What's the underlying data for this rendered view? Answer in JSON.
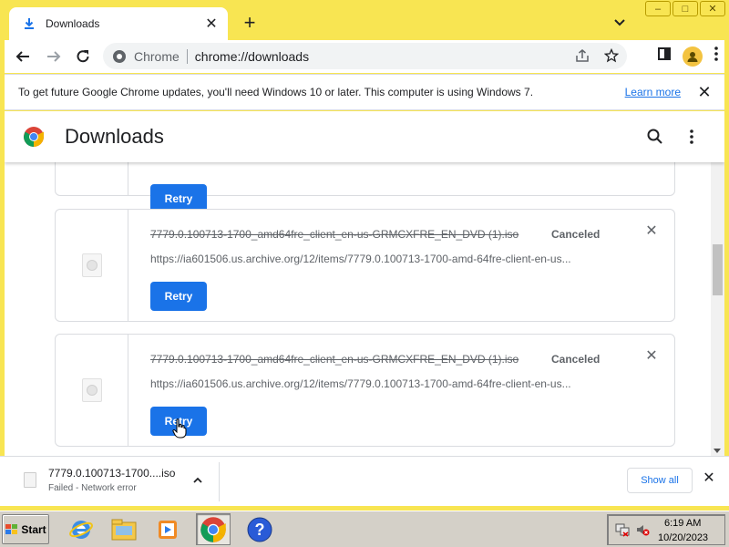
{
  "window": {
    "tab_title": "Downloads",
    "new_tab_label": "+",
    "tab_close_label": "✕",
    "controls": {
      "minimize": "–",
      "maximize": "□",
      "close": "✕"
    }
  },
  "toolbar": {
    "site_name": "Chrome",
    "url": "chrome://downloads"
  },
  "infobar": {
    "message": "To get future Google Chrome updates, you'll need Windows 10 or later. This computer is using Windows 7.",
    "link": "Learn more",
    "close_label": "✕"
  },
  "page": {
    "title": "Downloads",
    "downloads": [
      {
        "filename": "",
        "status": "",
        "url": "",
        "action": "Retry"
      },
      {
        "filename": "7779.0.100713-1700_amd64fre_client_en-us-GRMCXFRE_EN_DVD (1).iso",
        "status": "Canceled",
        "url": "https://ia601506.us.archive.org/12/items/7779.0.100713-1700-amd-64fre-client-en-us...",
        "action": "Retry",
        "remove_label": "✕"
      },
      {
        "filename": "7779.0.100713-1700_amd64fre_client_en-us-GRMCXFRE_EN_DVD (1).iso",
        "status": "Canceled",
        "url": "https://ia601506.us.archive.org/12/items/7779.0.100713-1700-amd-64fre-client-en-us...",
        "action": "Retry",
        "remove_label": "✕"
      }
    ]
  },
  "shelf": {
    "item_name": "7779.0.100713-1700....iso",
    "item_status": "Failed - Network error",
    "show_all": "Show all",
    "close_label": "✕"
  },
  "taskbar": {
    "start_label": "Start",
    "time": "6:19 AM",
    "date": "10/20/2023"
  },
  "colors": {
    "frame": "#f8e552",
    "accent": "#1a73e8"
  }
}
